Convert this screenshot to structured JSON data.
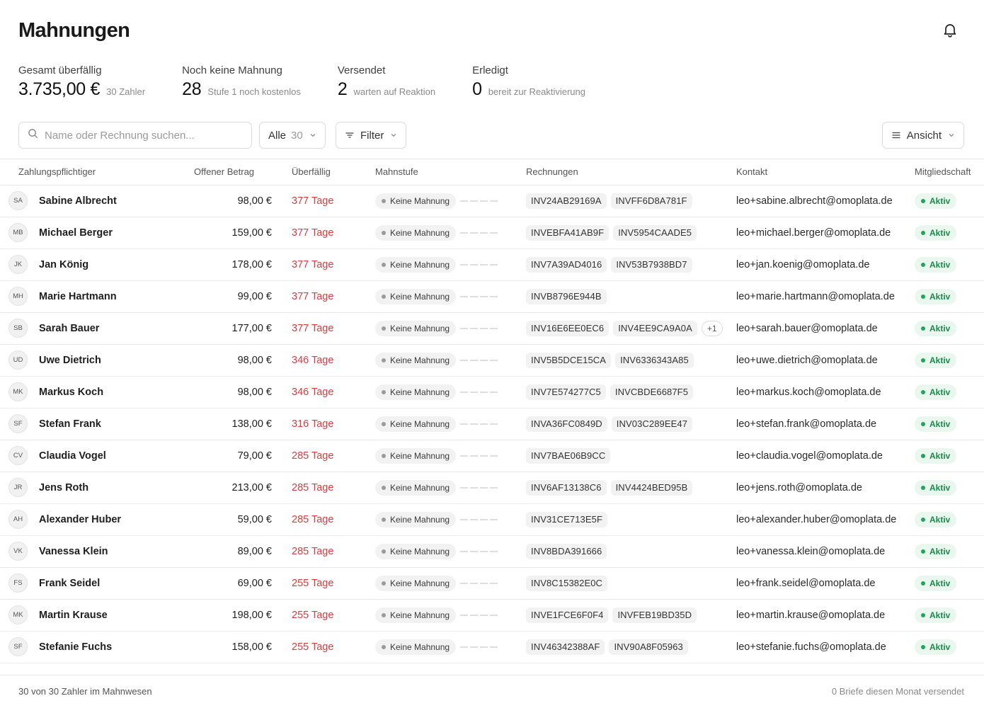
{
  "page": {
    "title": "Mahnungen"
  },
  "stats": [
    {
      "label": "Gesamt überfällig",
      "value": "3.735,00 €",
      "sub": "30 Zahler"
    },
    {
      "label": "Noch keine Mahnung",
      "value": "28",
      "sub": "Stufe 1 noch kostenlos"
    },
    {
      "label": "Versendet",
      "value": "2",
      "sub": "warten auf Reaktion"
    },
    {
      "label": "Erledigt",
      "value": "0",
      "sub": "bereit zur Reaktivierung"
    }
  ],
  "toolbar": {
    "search_placeholder": "Name oder Rechnung suchen...",
    "segment_label": "Alle",
    "segment_count": "30",
    "filter_label": "Filter",
    "view_label": "Ansicht"
  },
  "table": {
    "headers": [
      "Zahlungspflichtiger",
      "Offener Betrag",
      "Überfällig",
      "Mahnstufe",
      "Rechnungen",
      "Kontakt",
      "Mitgliedschaft"
    ],
    "rows": [
      {
        "initials": "SA",
        "name": "Sabine Albrecht",
        "amount": "98,00 €",
        "overdue": "377 Tage",
        "stage": "Keine Mahnung",
        "stage_progress": 0,
        "invoices": [
          "INV24AB29169A",
          "INVFF6D8A781F"
        ],
        "more": "",
        "contact": "leo+sabine.albrecht@omoplata.de",
        "membership": "Aktiv"
      },
      {
        "initials": "MB",
        "name": "Michael Berger",
        "amount": "159,00 €",
        "overdue": "377 Tage",
        "stage": "Keine Mahnung",
        "stage_progress": 0,
        "invoices": [
          "INVEBFA41AB9F",
          "INV5954CAADE5"
        ],
        "more": "",
        "contact": "leo+michael.berger@omoplata.de",
        "membership": "Aktiv"
      },
      {
        "initials": "JK",
        "name": "Jan König",
        "amount": "178,00 €",
        "overdue": "377 Tage",
        "stage": "Keine Mahnung",
        "stage_progress": 0,
        "invoices": [
          "INV7A39AD4016",
          "INV53B7938BD7"
        ],
        "more": "",
        "contact": "leo+jan.koenig@omoplata.de",
        "membership": "Aktiv"
      },
      {
        "initials": "MH",
        "name": "Marie Hartmann",
        "amount": "99,00 €",
        "overdue": "377 Tage",
        "stage": "Keine Mahnung",
        "stage_progress": 0,
        "invoices": [
          "INVB8796E944B"
        ],
        "more": "",
        "contact": "leo+marie.hartmann@omoplata.de",
        "membership": "Aktiv"
      },
      {
        "initials": "SB",
        "name": "Sarah Bauer",
        "amount": "177,00 €",
        "overdue": "377 Tage",
        "stage": "Keine Mahnung",
        "stage_progress": 0,
        "invoices": [
          "INV16E6EE0EC6",
          "INV4EE9CA9A0A"
        ],
        "more": "+1",
        "contact": "leo+sarah.bauer@omoplata.de",
        "membership": "Aktiv"
      },
      {
        "initials": "UD",
        "name": "Uwe Dietrich",
        "amount": "98,00 €",
        "overdue": "346 Tage",
        "stage": "Keine Mahnung",
        "stage_progress": 0,
        "invoices": [
          "INV5B5DCE15CA",
          "INV6336343A85"
        ],
        "more": "",
        "contact": "leo+uwe.dietrich@omoplata.de",
        "membership": "Aktiv"
      },
      {
        "initials": "MK",
        "name": "Markus Koch",
        "amount": "98,00 €",
        "overdue": "346 Tage",
        "stage": "Keine Mahnung",
        "stage_progress": 0,
        "invoices": [
          "INV7E574277C5",
          "INVCBDE6687F5"
        ],
        "more": "",
        "contact": "leo+markus.koch@omoplata.de",
        "membership": "Aktiv"
      },
      {
        "initials": "SF",
        "name": "Stefan Frank",
        "amount": "138,00 €",
        "overdue": "316 Tage",
        "stage": "Keine Mahnung",
        "stage_progress": 0,
        "invoices": [
          "INVA36FC0849D",
          "INV03C289EE47"
        ],
        "more": "",
        "contact": "leo+stefan.frank@omoplata.de",
        "membership": "Aktiv"
      },
      {
        "initials": "CV",
        "name": "Claudia Vogel",
        "amount": "79,00 €",
        "overdue": "285 Tage",
        "stage": "Keine Mahnung",
        "stage_progress": 0,
        "invoices": [
          "INV7BAE06B9CC"
        ],
        "more": "",
        "contact": "leo+claudia.vogel@omoplata.de",
        "membership": "Aktiv"
      },
      {
        "initials": "JR",
        "name": "Jens Roth",
        "amount": "213,00 €",
        "overdue": "285 Tage",
        "stage": "Keine Mahnung",
        "stage_progress": 0,
        "invoices": [
          "INV6AF13138C6",
          "INV4424BED95B"
        ],
        "more": "",
        "contact": "leo+jens.roth@omoplata.de",
        "membership": "Aktiv"
      },
      {
        "initials": "AH",
        "name": "Alexander Huber",
        "amount": "59,00 €",
        "overdue": "285 Tage",
        "stage": "Keine Mahnung",
        "stage_progress": 0,
        "invoices": [
          "INV31CE713E5F"
        ],
        "more": "",
        "contact": "leo+alexander.huber@omoplata.de",
        "membership": "Aktiv"
      },
      {
        "initials": "VK",
        "name": "Vanessa Klein",
        "amount": "89,00 €",
        "overdue": "285 Tage",
        "stage": "Keine Mahnung",
        "stage_progress": 0,
        "invoices": [
          "INV8BDA391666"
        ],
        "more": "",
        "contact": "leo+vanessa.klein@omoplata.de",
        "membership": "Aktiv"
      },
      {
        "initials": "FS",
        "name": "Frank Seidel",
        "amount": "69,00 €",
        "overdue": "255 Tage",
        "stage": "Keine Mahnung",
        "stage_progress": 0,
        "invoices": [
          "INV8C15382E0C"
        ],
        "more": "",
        "contact": "leo+frank.seidel@omoplata.de",
        "membership": "Aktiv"
      },
      {
        "initials": "MK",
        "name": "Martin Krause",
        "amount": "198,00 €",
        "overdue": "255 Tage",
        "stage": "Keine Mahnung",
        "stage_progress": 0,
        "invoices": [
          "INVE1FCE6F0F4",
          "INVFEB19BD35D"
        ],
        "more": "",
        "contact": "leo+martin.krause@omoplata.de",
        "membership": "Aktiv"
      },
      {
        "initials": "SF",
        "name": "Stefanie Fuchs",
        "amount": "158,00 €",
        "overdue": "255 Tage",
        "stage": "Keine Mahnung",
        "stage_progress": 0,
        "invoices": [
          "INV46342388AF",
          "INV90A8F05963"
        ],
        "more": "",
        "contact": "leo+stefanie.fuchs@omoplata.de",
        "membership": "Aktiv"
      }
    ]
  },
  "footer": {
    "left": "30 von 30 Zahler im Mahnwesen",
    "right": "0 Briefe diesen Monat versendet"
  },
  "colors": {
    "overdue": "#e0393e",
    "active_badge_bg": "#eaf7ef",
    "active_badge_text": "#1a8a4a",
    "border": "#e6e6e6"
  },
  "icons": {
    "notification": "bell-icon",
    "search": "search-icon",
    "filter": "filter-icon",
    "view": "list-icon",
    "dropdown": "chevron-down-icon"
  }
}
